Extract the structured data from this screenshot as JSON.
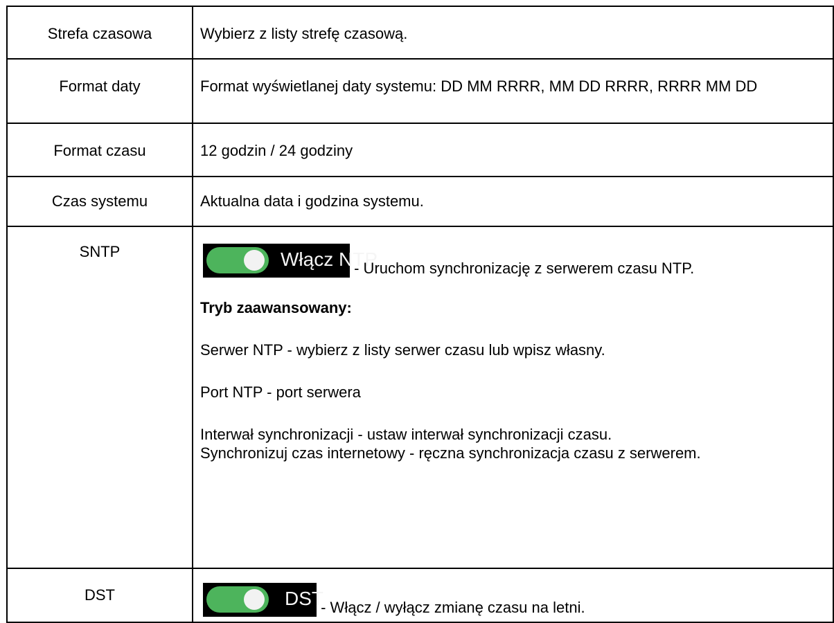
{
  "rows": [
    {
      "label": "Strefa czasowa",
      "description": "Wybierz z listy strefę czasową."
    },
    {
      "label": "Format daty",
      "description": "Format wyświetlanej daty systemu: DD MM RRRR, MM DD RRRR, RRRR MM DD"
    },
    {
      "label": "Format czasu",
      "description": "12 godzin / 24 godziny"
    },
    {
      "label": "Czas systemu",
      "description": "Aktualna data i godzina systemu."
    },
    {
      "label": "SNTP",
      "toggle_label": "Włącz NTP",
      "toggle_on": true,
      "toggle_description": " - Uruchom synchronizację z serwerem czasu NTP.",
      "advanced_heading": "Tryb zaawansowany:",
      "server_text": "Serwer NTP - wybierz z listy serwer czasu lub wpisz własny.",
      "port_text": "Port NTP - port serwera",
      "interval_text": "Interwał synchronizacji - ustaw interwał synchronizacji czasu.",
      "sync_text": "Synchronizuj czas internetowy - ręczna synchronizacja czasu z serwerem."
    },
    {
      "label": "DST",
      "toggle_label": "DST",
      "toggle_on": true,
      "toggle_description": " - Włącz / wyłącz zmianę czasu na letni."
    }
  ],
  "colors": {
    "toggle_on": "#4db45c",
    "toggle_knob": "#f2f2f2",
    "chip_background": "#000000",
    "border": "#000000"
  },
  "icons": {
    "toggle": "toggle-switch-on-icon"
  }
}
